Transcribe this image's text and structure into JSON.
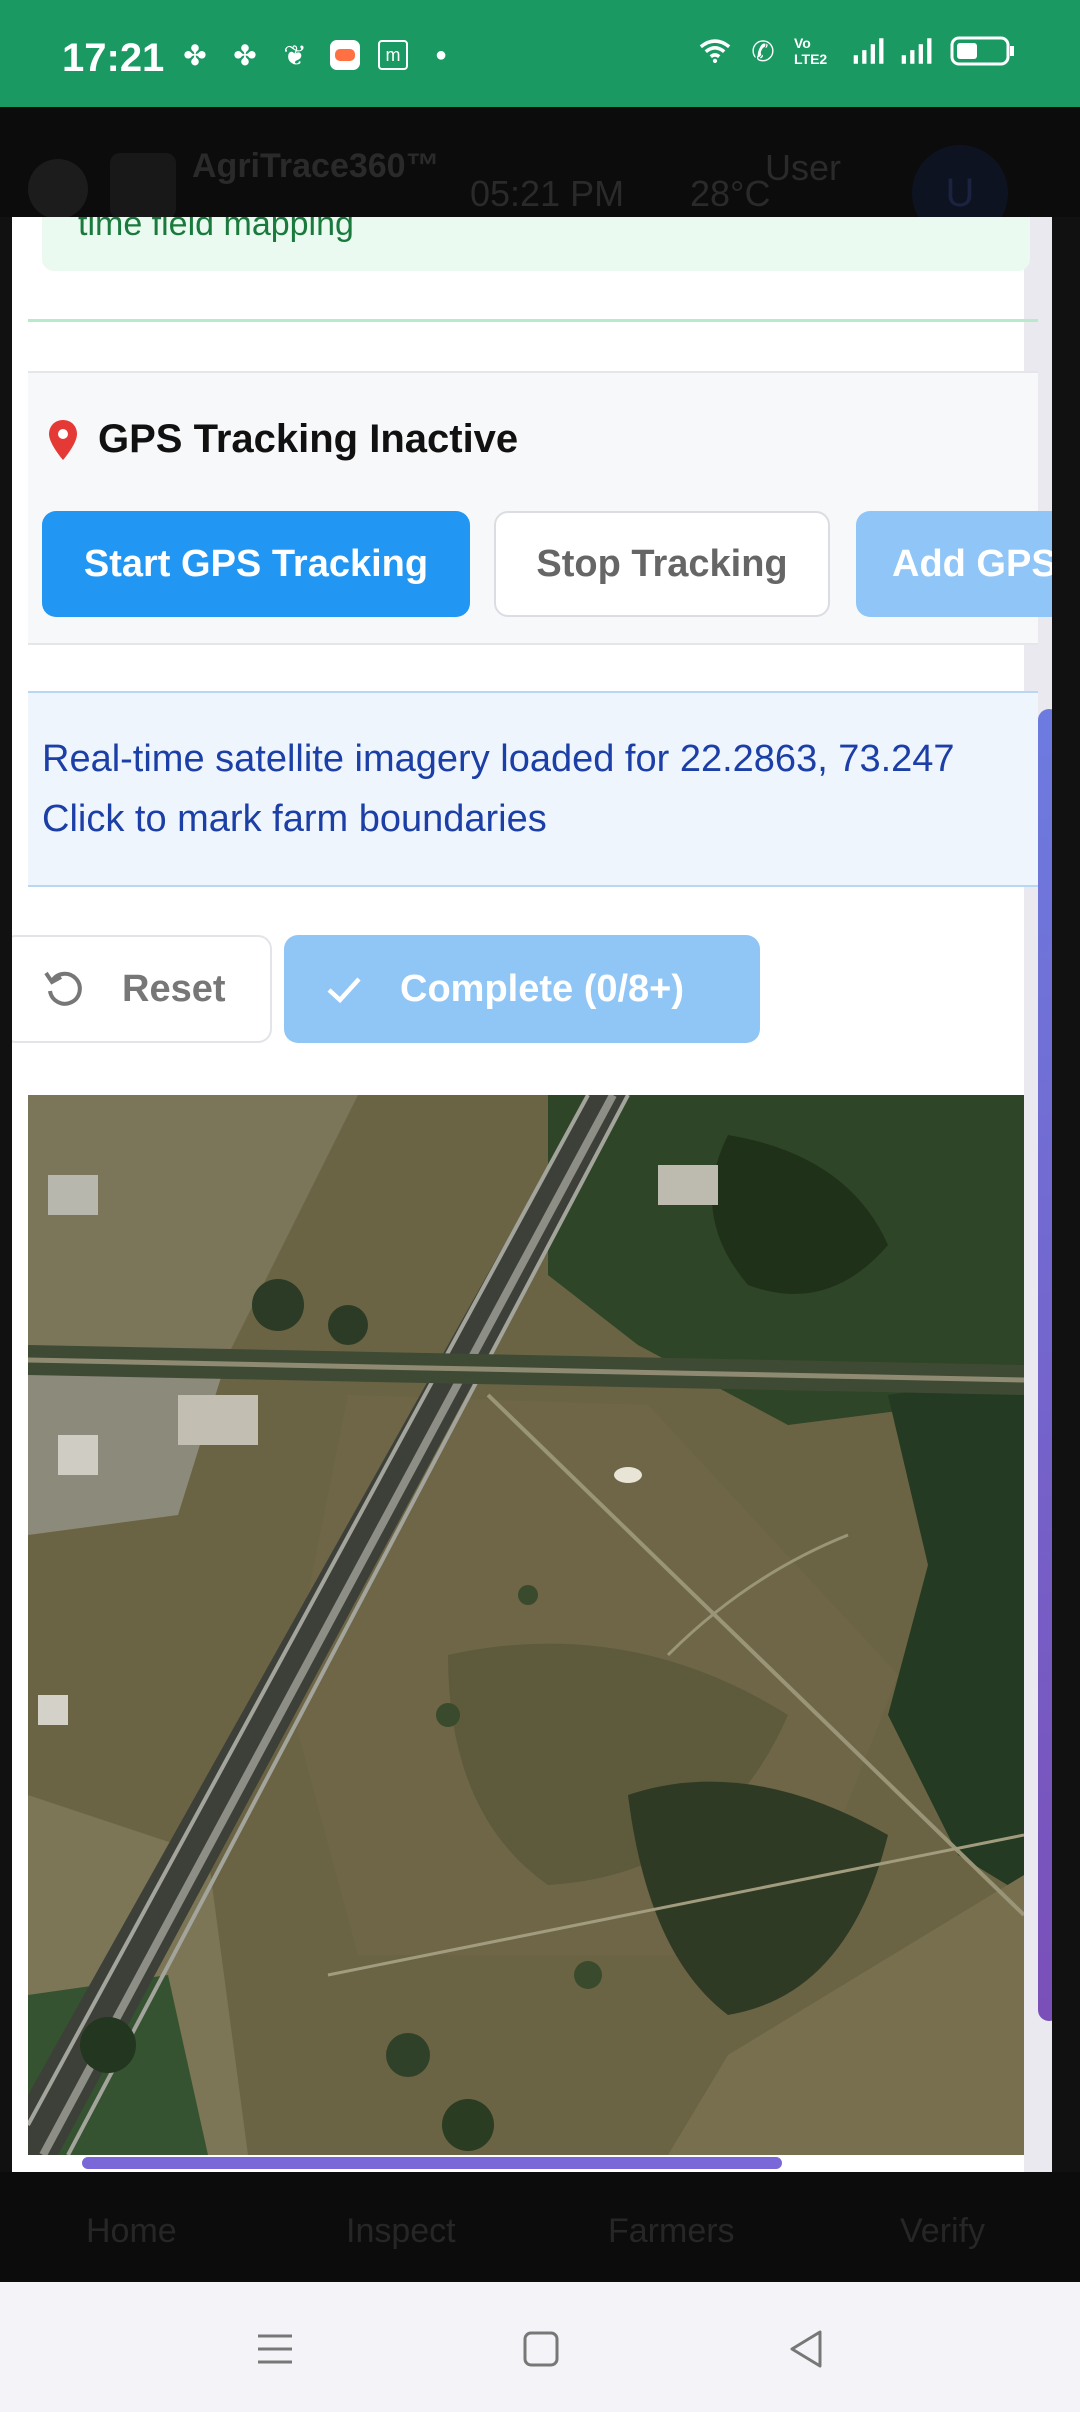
{
  "status_bar": {
    "time": "17:21",
    "wifi_icon": "wifi-icon",
    "call_icon": "wifi-call-icon",
    "volte_label": "Vo LTE2"
  },
  "app_header": {
    "title": "AgriTrace360™",
    "time": "05:21 PM",
    "temperature": "28°C",
    "user_label": "User",
    "avatar_letter": "U"
  },
  "modal": {
    "info_text": "time field mapping",
    "gps": {
      "status": "GPS Tracking Inactive",
      "start_label": "Start GPS Tracking",
      "stop_label": "Stop Tracking",
      "add_label": "Add GPS"
    },
    "satellite": {
      "line1": "Real-time satellite imagery loaded for 22.2863, 73.247",
      "line2": "Click to mark farm boundaries"
    },
    "actions": {
      "reset_label": "Reset",
      "complete_label": "Complete (0/8+)"
    }
  },
  "bottom_nav": {
    "items": [
      "Home",
      "Inspect",
      "Farmers",
      "Verify"
    ]
  },
  "colors": {
    "status_bar": "#1a9a62",
    "primary_button": "#2196f3",
    "disabled_button": "#90c6f6",
    "info_text": "#1b3fa6"
  }
}
